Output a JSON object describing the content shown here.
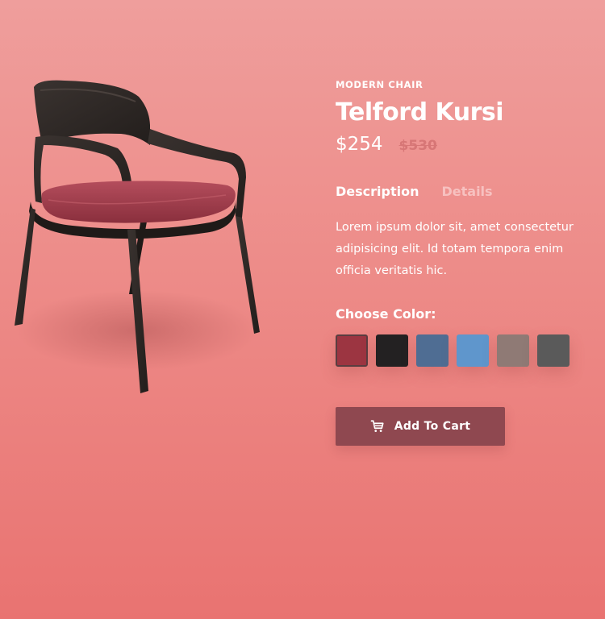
{
  "product": {
    "category": "MODERN CHAIR",
    "title": "Telford Kursi",
    "price_current": "$254",
    "price_old": "$530"
  },
  "tabs": [
    {
      "label": "Description",
      "active": true
    },
    {
      "label": "Details",
      "active": false
    }
  ],
  "description": {
    "lines": [
      "Lorem ipsum dolor sit, amet consectetur",
      "adipisicing elit. Id totam tempora enim",
      "officia veritatis hic."
    ]
  },
  "color_picker": {
    "label": "Choose Color:",
    "options": [
      {
        "name": "burgundy",
        "color": "#9c3541",
        "selected": true
      },
      {
        "name": "black",
        "color": "#232122",
        "selected": false
      },
      {
        "name": "denim-blue",
        "color": "#4f6d93",
        "selected": false
      },
      {
        "name": "sky-blue",
        "color": "#5f96cc",
        "selected": false
      },
      {
        "name": "taupe",
        "color": "#8f7a75",
        "selected": false
      },
      {
        "name": "charcoal-gray",
        "color": "#5a5a5a",
        "selected": false
      }
    ]
  },
  "cart": {
    "label": "Add To Cart",
    "icon": "shopping-cart-icon"
  },
  "colors": {
    "background_top": "#ef9e9c",
    "background_bottom": "#e97371",
    "button": "#8f4850",
    "price_old": "#d77676"
  }
}
